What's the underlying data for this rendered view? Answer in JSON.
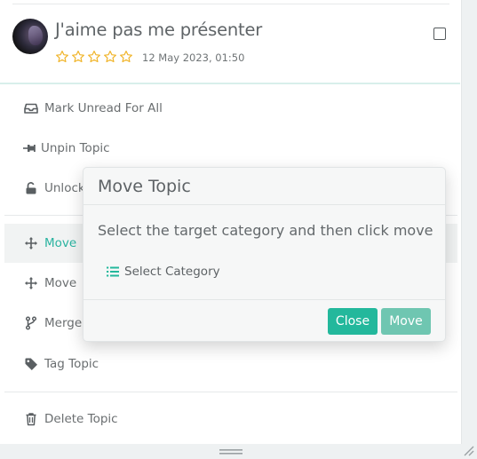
{
  "topic": {
    "title": "J'aime pas me présenter",
    "date": "12 May 2023, 01:50",
    "rating_stars": 5,
    "rating_filled": 0
  },
  "menu": {
    "items": [
      {
        "label": "Mark Unread For All",
        "icon": "inbox-icon"
      },
      {
        "label": "Unpin Topic",
        "icon": "unpin-icon"
      },
      {
        "label": "Unlock",
        "icon": "unlock-icon"
      },
      {
        "label": "Move",
        "icon": "move-icon"
      },
      {
        "label": "Move",
        "icon": "move-icon"
      },
      {
        "label": "Merge",
        "icon": "merge-icon"
      },
      {
        "label": "Tag Topic",
        "icon": "tag-icon"
      },
      {
        "label": "Delete Topic",
        "icon": "trash-icon"
      }
    ]
  },
  "modal": {
    "title": "Move Topic",
    "text": "Select the target category and then click move",
    "select_label": "Select Category",
    "close_label": "Close",
    "move_label": "Move"
  },
  "colors": {
    "accent": "#23b89c",
    "accent_light": "#6fc6b1",
    "star": "#f0b429",
    "text": "#6a6e70"
  }
}
